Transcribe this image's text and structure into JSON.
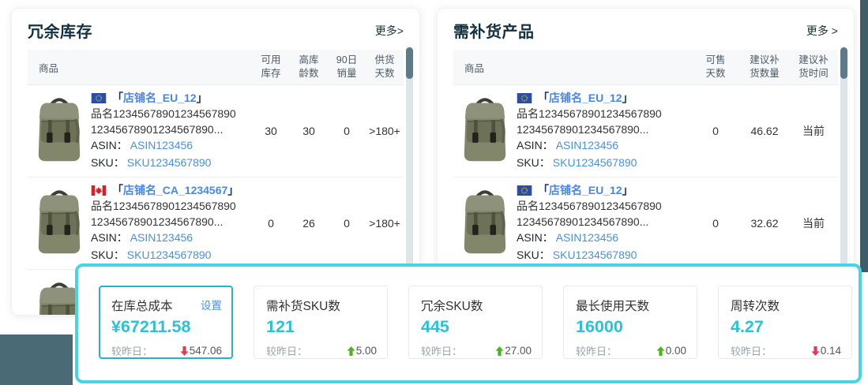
{
  "left_panel": {
    "title": "冗余库存",
    "more": "更多>",
    "product_col": "商品",
    "columns": [
      {
        "l1": "可用",
        "l2": "库存"
      },
      {
        "l1": "高库",
        "l2": "龄数"
      },
      {
        "l1": "90日",
        "l2": "销量"
      },
      {
        "l1": "供货",
        "l2": "天数"
      }
    ],
    "rows": [
      {
        "flag": "flag-eu",
        "bracket_open": "「",
        "store": "店铺名_EU_12",
        "bracket_close": "」",
        "name1": "品名12345678901234567890",
        "name2": "12345678901234567890...",
        "asin_label": "ASIN：",
        "asin": "ASIN123456",
        "sku_label": "SKU：",
        "sku": "SKU1234567890",
        "values": [
          "30",
          "30",
          "0",
          ">180+"
        ]
      },
      {
        "flag": "flag-ca",
        "bracket_open": "「",
        "store": "店铺名_CA_1234567",
        "bracket_close": "」",
        "name1": "品名12345678901234567890",
        "name2": "12345678901234567890...",
        "asin_label": "ASIN：",
        "asin": "ASIN123456",
        "sku_label": "SKU：",
        "sku": "SKU1234567890",
        "values": [
          "0",
          "26",
          "0",
          ">180+"
        ]
      }
    ]
  },
  "right_panel": {
    "title": "需补货产品",
    "more": "更多 >",
    "product_col": "商品",
    "columns": [
      {
        "l1": "可售",
        "l2": "天数"
      },
      {
        "l1": "建议补",
        "l2": "货数量"
      },
      {
        "l1": "建议补",
        "l2": "货时间"
      }
    ],
    "rows": [
      {
        "flag": "flag-eu",
        "bracket_open": "「",
        "store": "店铺名_EU_12",
        "bracket_close": "」",
        "name1": "品名12345678901234567890",
        "name2": "12345678901234567890...",
        "asin_label": "ASIN：",
        "asin": "ASIN123456",
        "sku_label": "SKU：",
        "sku": "SKU1234567890",
        "values": [
          "0",
          "46.62",
          "当前"
        ]
      },
      {
        "flag": "flag-eu",
        "bracket_open": "「",
        "store": "店铺名_EU_12",
        "bracket_close": "」",
        "name1": "品名12345678901234567890",
        "name2": "12345678901234567890...",
        "asin_label": "ASIN：",
        "asin": "ASIN123456",
        "sku_label": "SKU：",
        "sku": "SKU1234567890",
        "values": [
          "0",
          "32.62",
          "当前"
        ]
      }
    ]
  },
  "stats": {
    "cards": [
      {
        "title": "在库总成本",
        "action": "设置",
        "value": "¥67211.58",
        "compare": "较昨日：",
        "delta": "547.06",
        "trend": "down"
      },
      {
        "title": "需补货SKU数",
        "value": "121",
        "compare": "较昨日：",
        "delta": "5.00",
        "trend": "up"
      },
      {
        "title": "冗余SKU数",
        "value": "445",
        "compare": "较昨日：",
        "delta": "27.00",
        "trend": "up"
      },
      {
        "title": "最长使用天数",
        "value": "16000",
        "compare": "较昨日：",
        "delta": "0.00",
        "trend": "up"
      },
      {
        "title": "周转次数",
        "value": "4.27",
        "compare": "较昨日：",
        "delta": "0.14",
        "trend": "down"
      }
    ]
  },
  "colors": {
    "accent_cyan": "#46d4e7",
    "kpi_value": "#29c2d6",
    "trend_up": "#4db31e",
    "trend_down": "#e23c55",
    "link_blue": "#4a90e2",
    "dark_corner": "#4a6a76",
    "dark_edge": "#3f5d68"
  }
}
